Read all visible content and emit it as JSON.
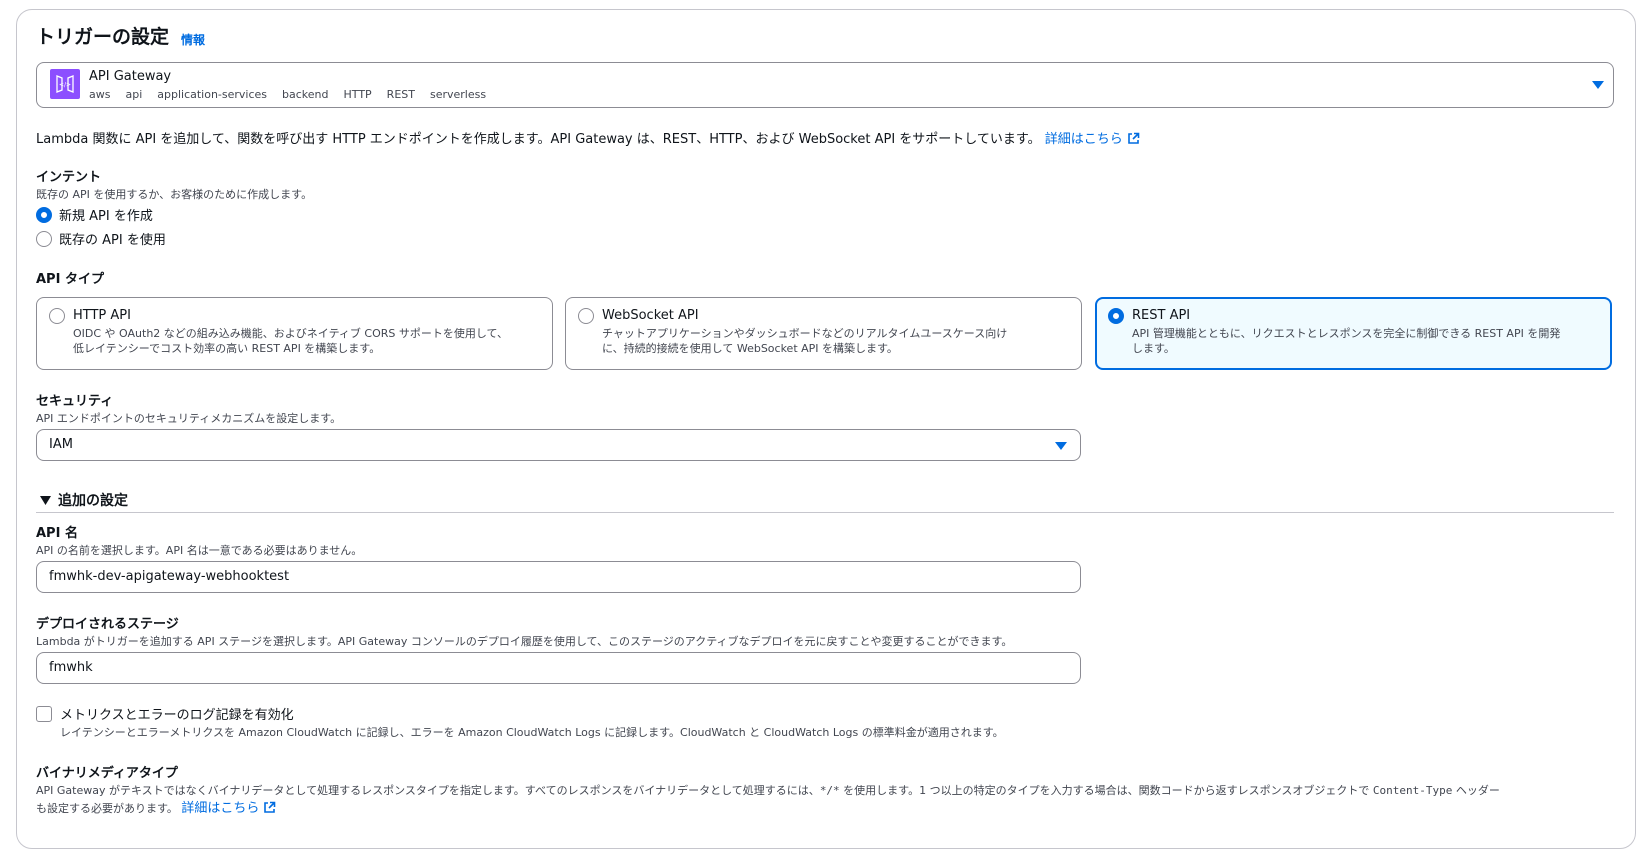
{
  "header": {
    "title": "トリガーの設定",
    "info_link": "情報"
  },
  "source_select": {
    "service_name": "API Gateway",
    "tags": [
      "aws",
      "api",
      "application-services",
      "backend",
      "HTTP",
      "REST",
      "serverless"
    ]
  },
  "intro": {
    "text": "Lambda 関数に API を追加して、関数を呼び出す HTTP エンドポイントを作成します。API Gateway は、REST、HTTP、および WebSocket API をサポートしています。",
    "link": "詳細はこちら"
  },
  "intent": {
    "label": "インテント",
    "description": "既存の API を使用するか、お客様のために作成します。",
    "options": [
      {
        "label": "新規 API を作成",
        "selected": true
      },
      {
        "label": "既存の API を使用",
        "selected": false
      }
    ]
  },
  "api_type": {
    "label": "API タイプ",
    "cards": [
      {
        "title": "HTTP API",
        "line1": "OIDC や OAuth2 などの組み込み機能、およびネイティブ CORS サポートを使用して、",
        "line2": "低レイテンシーでコスト効率の高い REST API を構築します。",
        "selected": false
      },
      {
        "title": "WebSocket API",
        "line1": "チャットアプリケーションやダッシュボードなどのリアルタイムユースケース向け",
        "line2": "に、持続的接続を使用して WebSocket API を構築します。",
        "selected": false
      },
      {
        "title": "REST API",
        "line1": "API 管理機能とともに、リクエストとレスポンスを完全に制御できる REST API を開発",
        "line2": "します。",
        "selected": true
      }
    ]
  },
  "security": {
    "label": "セキュリティ",
    "description": "API エンドポイントのセキュリティメカニズムを設定します。",
    "value": "IAM"
  },
  "additional": {
    "toggle_label": "追加の設定"
  },
  "api_name": {
    "label": "API 名",
    "description": "API の名前を選択します。API 名は一意である必要はありません。",
    "value": "fmwhk-dev-apigateway-webhooktest"
  },
  "stage": {
    "label": "デプロイされるステージ",
    "description": "Lambda がトリガーを追加する API ステージを選択します。API Gateway コンソールのデプロイ履歴を使用して、このステージのアクティブなデプロイを元に戻すことや変更することができます。",
    "value": "fmwhk"
  },
  "metrics": {
    "label": "メトリクスとエラーのログ記録を有効化",
    "description": "レイテンシーとエラーメトリクスを Amazon CloudWatch に記録し、エラーを Amazon CloudWatch Logs に記録します。CloudWatch と CloudWatch Logs の標準料金が適用されます。",
    "checked": false
  },
  "binary": {
    "label": "バイナリメディアタイプ",
    "line1_a": "API Gateway がテキストではなくバイナリデータとして処理するレスポンスタイプを指定します。すべてのレスポンスをバイナリデータとして処理するには、",
    "wildcard": "*/*",
    "line1_b": " を使用します。1 つ以上の特定のタイプを入力する場合は、関数コードから返すレスポンスオブジェクトで ",
    "header_name": "Content-Type",
    "line1_c": " ヘッダー",
    "line2": "も設定する必要があります。",
    "link": "詳細はこちら"
  },
  "colors": {
    "accent": "#006ce0",
    "service_icon": "#8c4fff",
    "selected_card_bg": "#f0fbff"
  }
}
